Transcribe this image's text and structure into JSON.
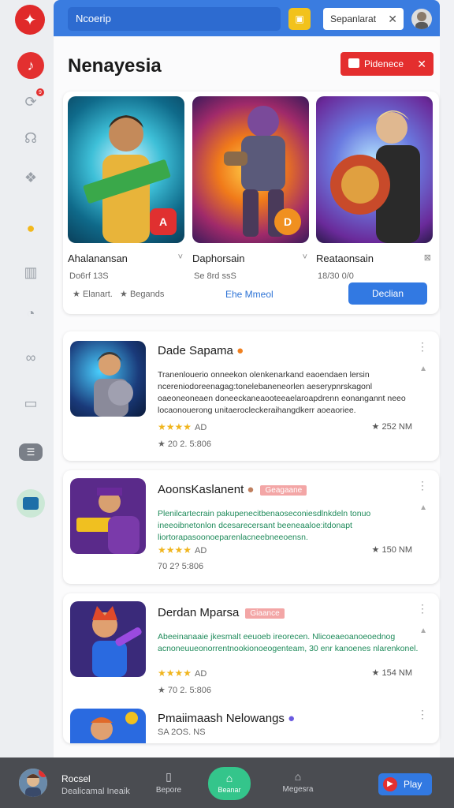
{
  "topbar": {
    "search_value": "Ncoerip",
    "filter_label": "Sepanlarat",
    "filter_close": "✕"
  },
  "page": {
    "title": "Nenayesia",
    "primary_button": "Pidenece",
    "primary_close": "✕"
  },
  "featured": {
    "items": [
      {
        "name": "Ahalanansan",
        "sub": "Do6rf 13S",
        "mark": "˅"
      },
      {
        "name": "Daphorsain",
        "sub": "Se 8rd ssS",
        "mark": "˅"
      },
      {
        "name": "Reataonsain",
        "sub": "18/30 0/0",
        "mark": "⊠"
      }
    ],
    "badge_1": "A",
    "badge_2": "D",
    "footer_1": "Elanart.",
    "footer_2": "Begands",
    "link": "Ehe Mmeol",
    "cta": "Declian"
  },
  "list": [
    {
      "title": "Dade Sapama",
      "tag": "",
      "desc": "Tranenlouerio onneekon olenkenarkand eaoendaen lersin ncereniodoreenagag:tonelebaneneorlen aeserypnrskagonl oaeoneoneaen doneeckaneaooteeaelaroapdrenn eonangannt neeo locaonouerong unitaerocleckeraihangdkerr aoeaoriee.",
      "green": false,
      "stars": "★★★★",
      "rating": "AD",
      "meta": "20 2. 5:806",
      "count": "252 NM"
    },
    {
      "title": "AoonsKaslanent",
      "tag": "Geagaane",
      "desc": "Plenilcartecrain pakupenecitbenaoseconiesdlnkdeln tonuo ineeoibnetonlon dcesarecersant beeneaaloe:itdonapt liortorapasoonoeparenlacneebneeoensn.",
      "green": true,
      "stars": "★★★★",
      "rating": "AD",
      "meta": "70 2? 5:806",
      "count": "150 NM"
    },
    {
      "title": "Derdan Mparsa",
      "tag": "Giaance",
      "desc": "Abeeinanaaie jkesmalt eeuoeb ireorecen. Nlicoeaeoanoeoednog acnoneuueonorrentnookionoeogenteam, 30 enr kanoenes nlarenkonel.",
      "green": true,
      "stars": "★★★★",
      "rating": "AD",
      "meta": "70 2. 5:806",
      "count": "154 NM"
    },
    {
      "title": "Pmaiimaash Nelowangs",
      "tag": "",
      "desc": "",
      "green": false,
      "stars": "",
      "rating": "",
      "meta": "SA 2OS. NS",
      "count": ""
    }
  ],
  "bottom": {
    "name": "Rocsel",
    "sub": "Dealicamal Ineaik",
    "tab_1": "Bepore",
    "tab_active": "Beanar",
    "tab_3": "Megesra",
    "play": "Play"
  },
  "colors": {
    "accent_blue": "#3a7ce0",
    "accent_red": "#e42e2e",
    "accent_green": "#34c58b"
  }
}
